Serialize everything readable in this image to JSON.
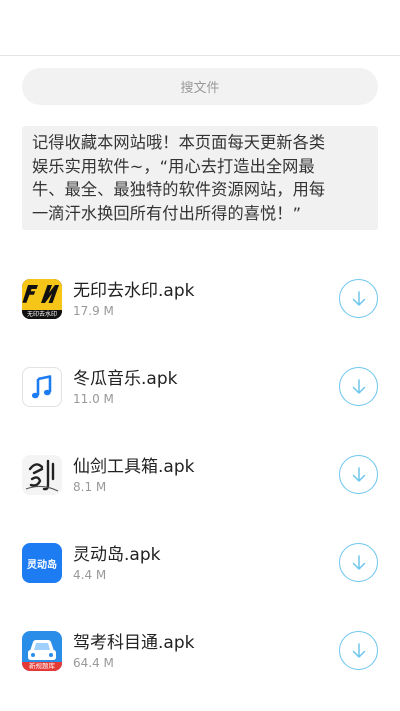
{
  "search": {
    "placeholder": "搜文件"
  },
  "notice": {
    "lines": [
      "记得收藏本网站哦！本页面每天更新各类",
      "娱乐实用软件~，“用心去打造出全网最",
      "牛、最全、最独特的软件资源网站，用每",
      "一滴汗水换回所有付出所得的喜悦！”"
    ]
  },
  "files": [
    {
      "name": "无印去水印.apk",
      "size": "17.9 M",
      "icon": "wuyin-app-icon",
      "icon_text": "无印去水印"
    },
    {
      "name": "冬瓜音乐.apk",
      "size": "11.0 M",
      "icon": "music-note-app-icon"
    },
    {
      "name": "仙剑工具箱.apk",
      "size": "8.1 M",
      "icon": "calligraphy-sword-app-icon"
    },
    {
      "name": "灵动岛.apk",
      "size": "4.4 M",
      "icon": "lingdongdao-app-icon",
      "icon_text": "灵动岛"
    },
    {
      "name": "驾考科目通.apk",
      "size": "64.4 M",
      "icon": "car-app-icon",
      "icon_text": "新规题库"
    }
  ],
  "colors": {
    "accent": "#6cc6ec",
    "wuyin_icon_bg": "#f5c518",
    "lingdongdao_icon_bg": "#1e7cf2",
    "car_icon_bg": "#2a8de8",
    "car_banner": "#e53935"
  }
}
